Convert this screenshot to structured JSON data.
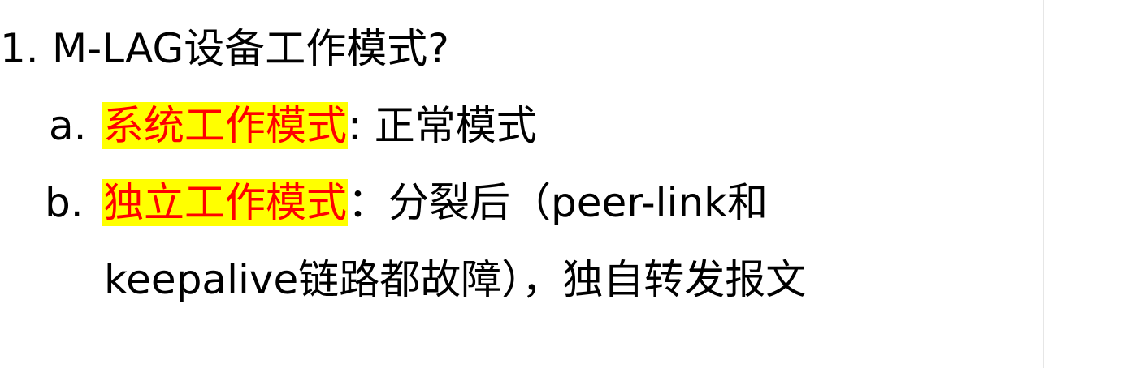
{
  "list": {
    "item1": {
      "marker": "1.",
      "text": "M-LAG设备工作模式?"
    },
    "item_a": {
      "marker": "a.",
      "highlight": "系统工作模式",
      "text": ": 正常模式"
    },
    "item_b": {
      "marker": "b.",
      "highlight": "独立工作模式",
      "text": "：分裂后（peer-link和",
      "continuation": "keepalive链路都故障），独自转发报文"
    }
  },
  "colors": {
    "highlight_background": "#ffff00",
    "highlight_text": "#ff0000",
    "body_text": "#000000"
  }
}
